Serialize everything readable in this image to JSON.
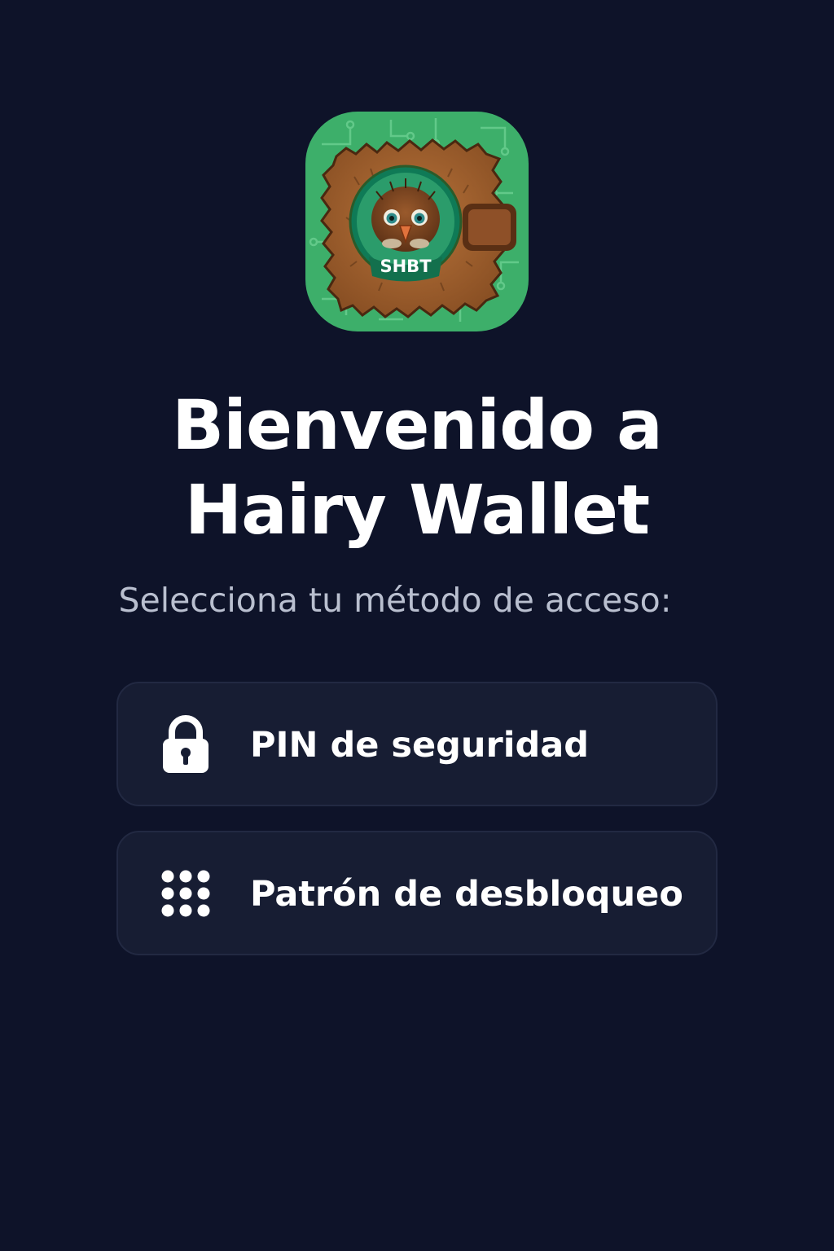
{
  "app": {
    "logo_badge": "SHBT",
    "logo_icon": "hairy-wallet-logo-icon"
  },
  "welcome": {
    "title_line1": "Bienvenido a",
    "title_line2": "Hairy Wallet",
    "subtitle": "Selecciona tu método de acceso:"
  },
  "options": [
    {
      "label": "PIN de seguridad",
      "icon": "lock-icon"
    },
    {
      "label": "Patrón de desbloqueo",
      "icon": "pattern-grid-icon"
    }
  ],
  "colors": {
    "background": "#0e1329",
    "card": "#171d33",
    "logo_green": "#3daf6a",
    "text_primary": "#ffffff",
    "text_secondary": "#b9bfcf"
  }
}
